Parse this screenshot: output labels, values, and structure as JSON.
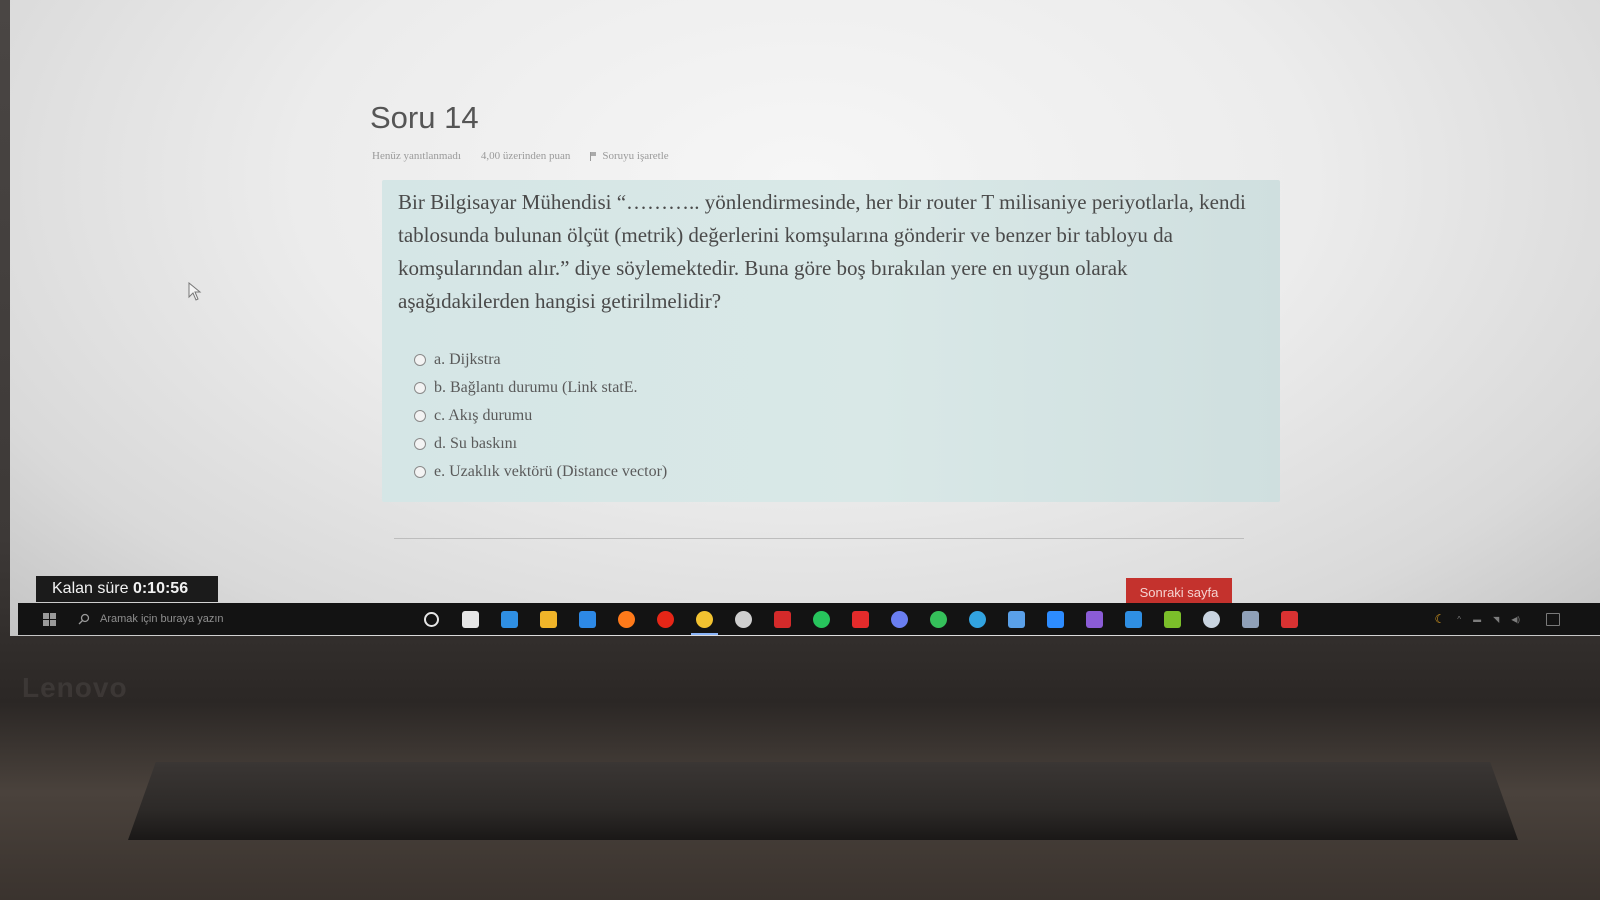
{
  "question": {
    "title": "Soru 14",
    "status": "Henüz yanıtlanmadı",
    "points": "4,00 üzerinden puan",
    "flag_label": "Soruyu işaretle",
    "text": "Bir Bilgisayar Mühendisi “……….. yönlendirmesinde, her bir router T milisaniye periyotlarla, kendi tablosunda bulunan ölçüt (metrik) değerlerini komşularına gönderir ve benzer bir tabloyu da komşularından alır.” diye söylemektedir. Buna göre boş bırakılan yere en uygun olarak aşağıdakilerden hangisi getirilmelidir?",
    "answers": [
      {
        "label": "a. Dijkstra"
      },
      {
        "label": "b. Bağlantı durumu (Link statE."
      },
      {
        "label": "c. Akış durumu"
      },
      {
        "label": "d. Su baskını"
      },
      {
        "label": "e. Uzaklık vektörü (Distance vector)"
      }
    ]
  },
  "timer": {
    "label": "Kalan süre",
    "value": "0:10:56"
  },
  "navigation": {
    "next_label": "Sonraki sayfa"
  },
  "taskbar": {
    "search_placeholder": "Aramak için buraya yazın",
    "icons": [
      {
        "name": "cortana-icon",
        "color": "#e6e6e6"
      },
      {
        "name": "task-view-icon",
        "color": "#e6e6e6"
      },
      {
        "name": "app-blue-arrow-icon",
        "color": "#2f8fe3"
      },
      {
        "name": "file-explorer-icon",
        "color": "#f0b429"
      },
      {
        "name": "mail-icon",
        "color": "#2d89e6"
      },
      {
        "name": "firefox-icon",
        "color": "#ff7a1a"
      },
      {
        "name": "opera-icon",
        "color": "#e62617"
      },
      {
        "name": "chrome-icon",
        "color": "#f2c230",
        "active": true
      },
      {
        "name": "gauge-icon",
        "color": "#cfcfcf"
      },
      {
        "name": "red-app-icon",
        "color": "#d42a2a"
      },
      {
        "name": "spotify-icon",
        "color": "#27c45c"
      },
      {
        "name": "youtube-icon",
        "color": "#e52b2b"
      },
      {
        "name": "discord-icon",
        "color": "#6a7ef0"
      },
      {
        "name": "whatsapp-icon",
        "color": "#35c05a"
      },
      {
        "name": "telegram-icon",
        "color": "#32a3e0"
      },
      {
        "name": "chat-app-icon",
        "color": "#5aa0e8"
      },
      {
        "name": "zoom-icon",
        "color": "#2d8cff"
      },
      {
        "name": "visual-studio-icon",
        "color": "#8b5cd6"
      },
      {
        "name": "vscode-icon",
        "color": "#2f8fe3"
      },
      {
        "name": "android-app-icon",
        "color": "#7bbf2a"
      },
      {
        "name": "steam-icon",
        "color": "#c9d4e0"
      },
      {
        "name": "keyboard-app-icon",
        "color": "#8fa0b8"
      },
      {
        "name": "red-square-app-icon",
        "color": "#d93232"
      }
    ]
  }
}
